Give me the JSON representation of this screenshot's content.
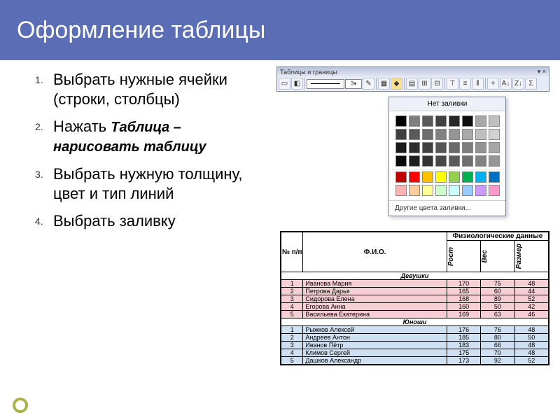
{
  "title": "Оформление таблицы",
  "steps": [
    {
      "num": "1.",
      "text": "Выбрать нужные ячейки (строки, столбцы)"
    },
    {
      "num": "2.",
      "prefix": "Нажать ",
      "bold": "Таблица – нарисовать таблицу"
    },
    {
      "num": "3.",
      "text": "Выбрать нужную толщину, цвет и тип линий"
    },
    {
      "num": "4.",
      "text": "Выбрать заливку"
    }
  ],
  "toolbar": {
    "title": "Таблицы и границы",
    "close": "×",
    "thickness_value": "3",
    "fill_none": "Нет заливки",
    "more_colors": "Другие цвета заливки..."
  },
  "palette_grays": [
    "#000000",
    "#7f7f7f",
    "#595959",
    "#404040",
    "#262626",
    "#0d0d0d",
    "#a6a6a6",
    "#bfbfbf",
    "#3f3f3f",
    "#5a5a5a",
    "#6e6e6e",
    "#828282",
    "#969696",
    "#aaaaaa",
    "#bebebe",
    "#d2d2d2",
    "#1a1a1a",
    "#2e2e2e",
    "#424242",
    "#565656",
    "#6a6a6a",
    "#7e7e7e",
    "#929292",
    "#a6a6a6",
    "#0a0a0a",
    "#1e1e1e",
    "#323232",
    "#464646",
    "#5a5a5a",
    "#6e6e6e",
    "#828282",
    "#969696"
  ],
  "palette_colors": [
    "#c00000",
    "#ff0000",
    "#ffc000",
    "#ffff00",
    "#92d050",
    "#00b050",
    "#00b0f0",
    "#0070c0",
    "#ffb3b3",
    "#ffcc99",
    "#ffff99",
    "#ccffcc",
    "#ccffff",
    "#99ccff",
    "#cc99ff",
    "#ff99cc"
  ],
  "table": {
    "col_num": "№ п/п",
    "col_fio": "Ф.И.О.",
    "col_group": "Физиологические данные",
    "col_height": "Рост",
    "col_weight": "Вес",
    "col_size": "Размер",
    "section_girls": "Девушки",
    "section_boys": "Юноши",
    "girls": [
      {
        "n": "1",
        "fio": "Иванова Мария",
        "h": "170",
        "w": "75",
        "s": "48"
      },
      {
        "n": "2",
        "fio": "Петрова Дарья",
        "h": "165",
        "w": "60",
        "s": "44"
      },
      {
        "n": "3",
        "fio": "Сидорова Елена",
        "h": "168",
        "w": "89",
        "s": "52"
      },
      {
        "n": "4",
        "fio": "Егорова Анна",
        "h": "160",
        "w": "50",
        "s": "42"
      },
      {
        "n": "5",
        "fio": "Васильева Екатерина",
        "h": "169",
        "w": "63",
        "s": "46"
      }
    ],
    "boys": [
      {
        "n": "1",
        "fio": "Рыжков Алексей",
        "h": "176",
        "w": "76",
        "s": "48"
      },
      {
        "n": "2",
        "fio": "Андреев Антон",
        "h": "185",
        "w": "80",
        "s": "50"
      },
      {
        "n": "3",
        "fio": "Иванов Пётр",
        "h": "183",
        "w": "66",
        "s": "48"
      },
      {
        "n": "4",
        "fio": "Климов Сергей",
        "h": "175",
        "w": "70",
        "s": "48"
      },
      {
        "n": "5",
        "fio": "Дашков Александр",
        "h": "173",
        "w": "92",
        "s": "52"
      }
    ]
  }
}
